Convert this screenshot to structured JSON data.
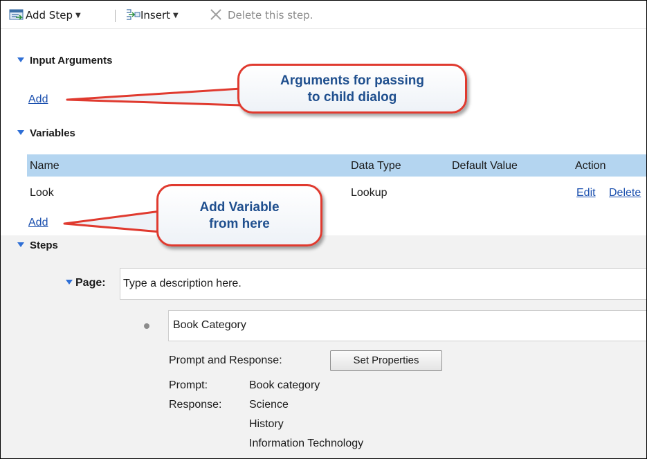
{
  "toolbar": {
    "add_step": "Add Step",
    "insert": "Insert",
    "delete": "Delete this step."
  },
  "input_arguments": {
    "title": "Input Arguments",
    "add_link": "Add"
  },
  "variables": {
    "title": "Variables",
    "columns": [
      "Name",
      "Data Type",
      "Default Value",
      "Action"
    ],
    "rows": [
      {
        "name": "Look",
        "data_type": "Lookup",
        "default_value": "",
        "actions": [
          "Edit",
          "Delete"
        ]
      }
    ],
    "add_link": "Add"
  },
  "steps": {
    "title": "Steps",
    "page_label": "Page:",
    "page_description": "Type a description here.",
    "step": {
      "name": "Book Category",
      "prompt_response_label": "Prompt and Response:",
      "set_properties_label": "Set Properties",
      "prompt_label": "Prompt:",
      "prompt_value": "Book category",
      "response_label": "Response:",
      "responses": [
        "Science",
        "History",
        "Information Technology"
      ]
    }
  },
  "callouts": {
    "arguments": [
      "Arguments for passing",
      "to child dialog"
    ],
    "variable": [
      "Add Variable",
      "from here"
    ]
  },
  "colors": {
    "callout_border": "#e03a2f",
    "callout_text": "#1f4f8e",
    "table_header": "#b4d5f0",
    "link": "#1a4fae",
    "triangle": "#2f6fd6"
  }
}
